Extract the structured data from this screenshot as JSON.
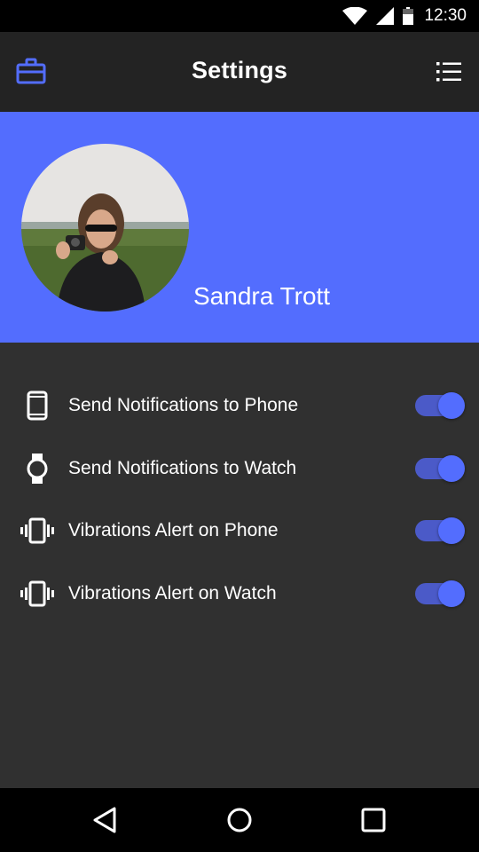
{
  "status_bar": {
    "time": "12:30",
    "icons": [
      "wifi-icon",
      "cell-signal-icon",
      "battery-icon"
    ]
  },
  "app_bar": {
    "title": "Settings",
    "left_icon": "briefcase-icon",
    "right_icon": "list-menu-icon"
  },
  "profile": {
    "name": "Sandra Trott",
    "avatar_description": "profile photo"
  },
  "settings": [
    {
      "label": "Send Notifications to Phone",
      "icon": "phone-icon",
      "enabled": true
    },
    {
      "label": "Send Notifications to Watch",
      "icon": "watch-icon",
      "enabled": true
    },
    {
      "label": "Vibrations Alert on Phone",
      "icon": "vibration-icon",
      "enabled": true
    },
    {
      "label": "Vibrations Alert on Watch",
      "icon": "vibration-icon",
      "enabled": true
    }
  ],
  "nav_bar": {
    "buttons": [
      "back-icon",
      "home-icon",
      "recents-icon"
    ]
  },
  "colors": {
    "accent": "#536dfe",
    "toggle_track": "#4b5ac8",
    "background": "#303030",
    "app_bar": "#232323"
  }
}
